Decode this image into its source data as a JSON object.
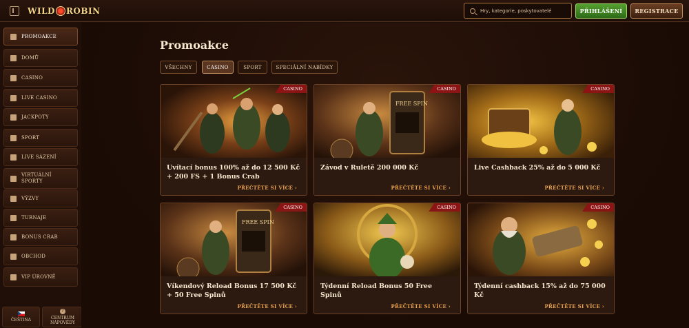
{
  "header": {
    "logo_left": "WILD",
    "logo_right": "ROBIN",
    "search_placeholder": "Hry, kategorie, poskytovatelé",
    "login_label": "PŘIHLÁŠENÍ",
    "register_label": "REGISTRACE"
  },
  "sidebar": {
    "items": [
      {
        "label": "PROMOAKCE",
        "icon": "gift-icon"
      },
      {
        "label": "DOMŮ",
        "icon": "home-icon"
      },
      {
        "label": "CASINO",
        "icon": "casino-icon"
      },
      {
        "label": "LIVE CASINO",
        "icon": "cards-icon"
      },
      {
        "label": "JACKPOTY",
        "icon": "clover-icon"
      },
      {
        "label": "SPORT",
        "icon": "ball-icon"
      },
      {
        "label": "LIVE SÁZENÍ",
        "icon": "live-icon"
      },
      {
        "label": "VIRTUÁLNÍ SPORTY",
        "icon": "virtual-icon"
      },
      {
        "label": "VÝZVY",
        "icon": "target-icon"
      },
      {
        "label": "TURNAJE",
        "icon": "trophy-icon"
      },
      {
        "label": "BONUS CRAB",
        "icon": "crab-icon"
      },
      {
        "label": "OBCHOD",
        "icon": "shop-icon"
      },
      {
        "label": "VIP ÚROVNĚ",
        "icon": "diamond-icon"
      }
    ],
    "language_label": "ČEŠTINA",
    "help_label_1": "CENTRUM",
    "help_label_2": "NÁPOVĚDY"
  },
  "main": {
    "title": "Promoakce",
    "filters": [
      "VŠECHNY",
      "CASINO",
      "SPORT",
      "SPECIÁLNÍ NABÍDKY"
    ],
    "active_filter": "CASINO",
    "cards": [
      {
        "title": "Uvítací bonus 100% až do 12 500 Kč + 200 FS + 1 Bonus Crab",
        "badge": "CASINO",
        "link": "PŘEČTĚTE SI VÍCE ›"
      },
      {
        "title": "Závod v Ruletě 200 000 Kč",
        "badge": "CASINO",
        "link": "PŘEČTĚTE SI VÍCE ›"
      },
      {
        "title": "Live Cashback 25% až do 5 000 Kč",
        "badge": "CASINO",
        "link": "PŘEČTĚTE SI VÍCE ›"
      },
      {
        "title": "Víkendový Reload Bonus 17 500 Kč + 50 Free Spinů",
        "badge": "CASINO",
        "link": "PŘEČTĚTE SI VÍCE ›"
      },
      {
        "title": "Týdenní Reload Bonus 50 Free Spinů",
        "badge": "CASINO",
        "link": "PŘEČTĚTE SI VÍCE ›"
      },
      {
        "title": "Týdenní cashback 15% až do 75 000 Kč",
        "badge": "CASINO",
        "link": "PŘEČTĚTE SI VÍCE ›"
      }
    ]
  },
  "colors": {
    "accent": "#e9a24e",
    "badge": "#8c1414",
    "login_green": "#3d8a22"
  }
}
